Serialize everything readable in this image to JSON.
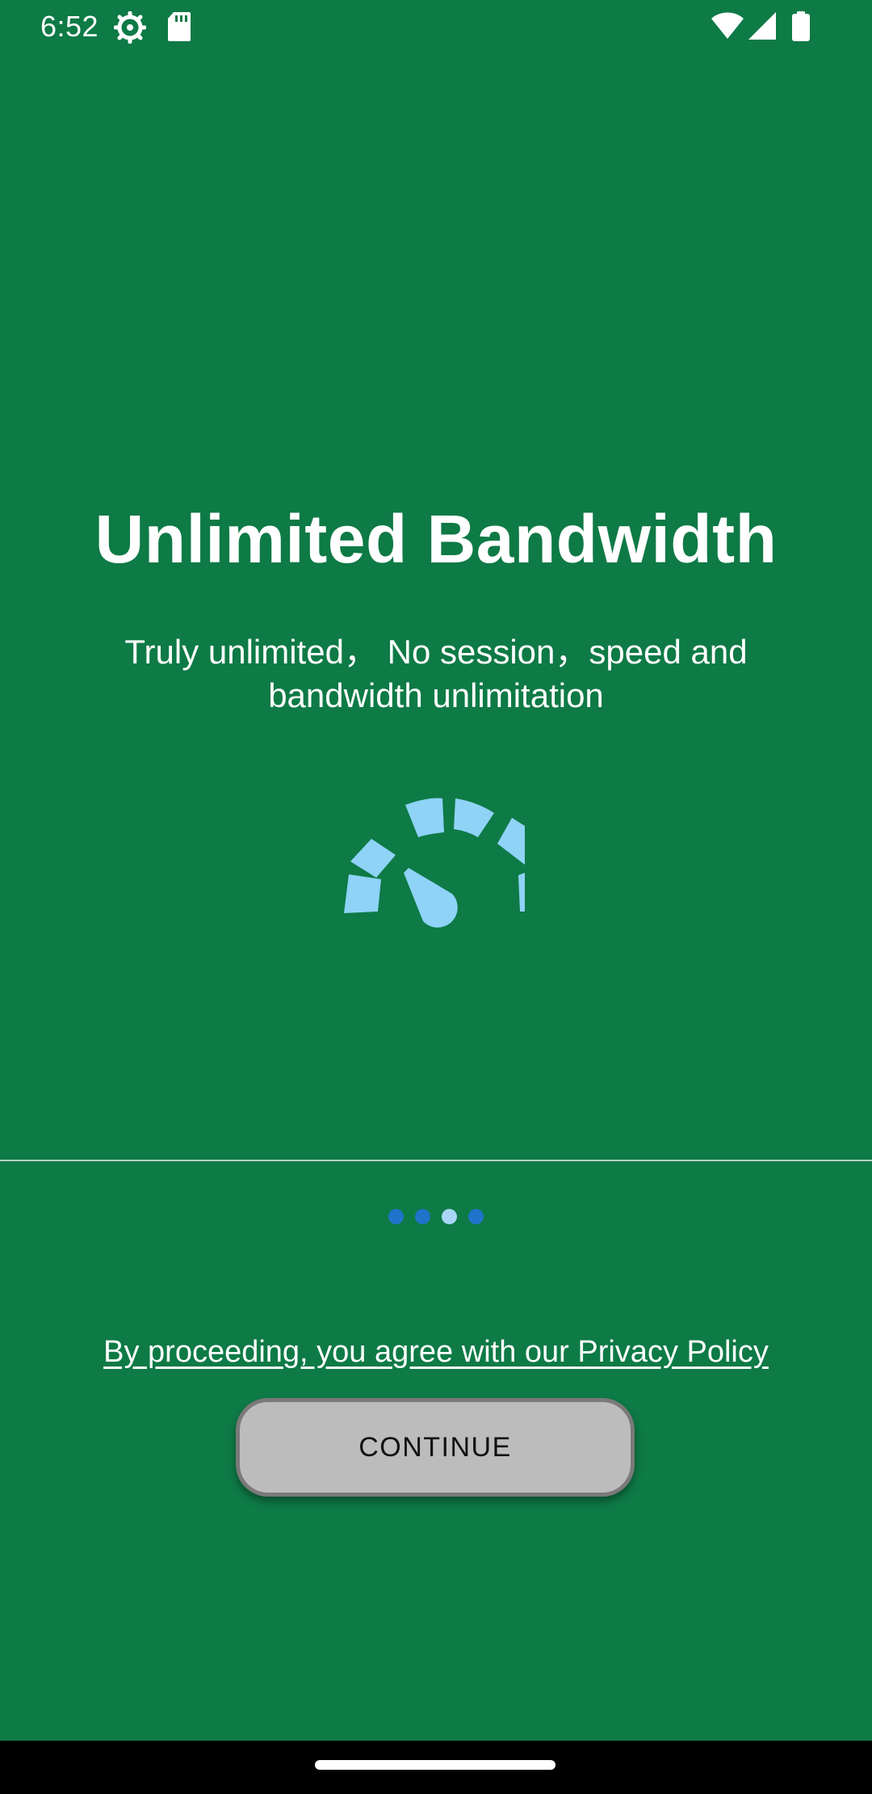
{
  "status_bar": {
    "time": "6:52",
    "icons": [
      "settings-gear-icon",
      "sd-card-icon",
      "wifi-icon",
      "cell-signal-icon",
      "battery-icon"
    ]
  },
  "onboarding": {
    "title": "Unlimited Bandwidth",
    "subtitle_line1": "Truly unlimited， No session，speed and",
    "subtitle_line2": "bandwidth unlimitation",
    "illustration_icon": "speedometer-icon",
    "page_indicator": {
      "count": 4,
      "active_index": 2
    },
    "privacy_text": "By proceeding, you agree with our Privacy Policy",
    "continue_label": "CONTINUE"
  },
  "colors": {
    "background": "#0e7a46",
    "gauge": "#8fd3f7",
    "dot": "#1f74c9",
    "dot_active": "#a9d6f6",
    "button": "#bcbcbc"
  }
}
